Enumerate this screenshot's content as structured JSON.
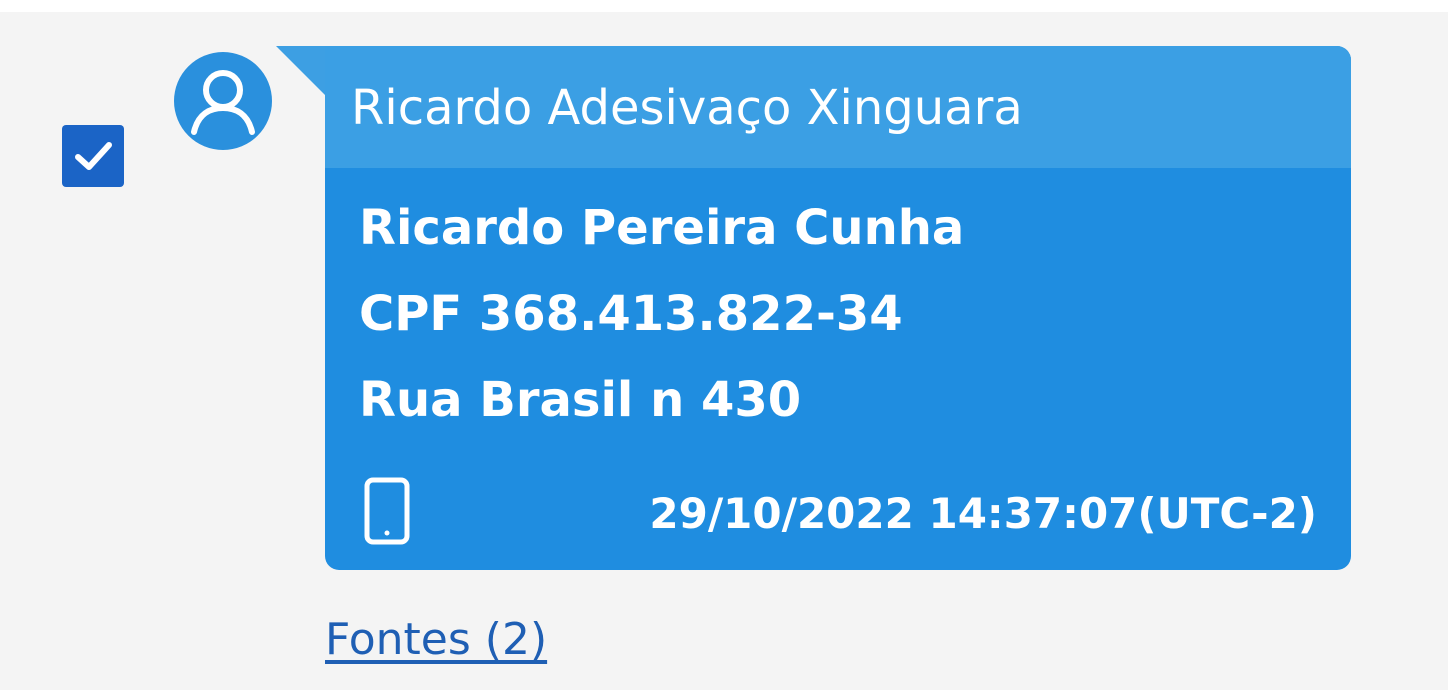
{
  "message": {
    "selected": true,
    "sender_name": "Ricardo Adesivaço Xinguara",
    "lines": [
      "Ricardo Pereira Cunha",
      "CPF 368.413.822-34",
      "Rua Brasil n 430"
    ],
    "source_icon": "mobile-phone-icon",
    "timestamp": "29/10/2022 14:37:07(UTC-2)"
  },
  "sources_link": "Fontes (2)",
  "colors": {
    "background": "#f4f4f4",
    "bubble": "#1f8de0",
    "bubble_header": "#3b9fe4",
    "checkbox": "#1b64c6",
    "link": "#1f5fb4",
    "text_on_bubble": "#ffffff"
  }
}
